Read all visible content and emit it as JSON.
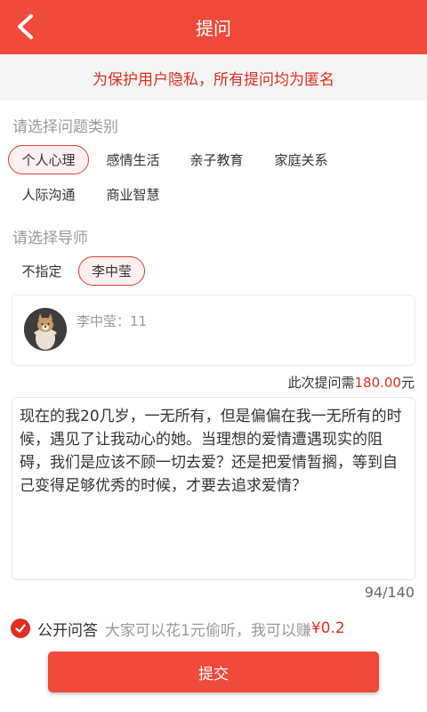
{
  "header": {
    "title": "提问"
  },
  "banner": {
    "text": "为保护用户隐私，所有提问均为匿名"
  },
  "category": {
    "title": "请选择问题类别",
    "options": [
      "个人心理",
      "感情生活",
      "亲子教育",
      "家庭关系",
      "人际沟通",
      "商业智慧"
    ],
    "selected": "个人心理"
  },
  "mentor": {
    "title": "请选择导师",
    "options": [
      "不指定",
      "李中莹"
    ],
    "selected": "李中莹",
    "card_text": "李中莹：11"
  },
  "price": {
    "prefix": "此次提问需",
    "amount": "180.00",
    "suffix": "元"
  },
  "question": {
    "text": "现在的我20几岁，一无所有，但是偏偏在我一无所有的时候，遇见了让我动心的她。当理想的爱情遭遇现实的阻碍，我们是应该不顾一切去爱？还是把爱情暂搁，等到自己变得足够优秀的时候，才要去追求爱情？",
    "counter": "94/140"
  },
  "public_answer": {
    "checked": true,
    "label": "公开问答",
    "hint": "大家可以花1元偷听，我可以赚",
    "earn": "¥0.2"
  },
  "submit": {
    "label": "提交"
  },
  "colors": {
    "accent": "#f04a3b",
    "price": "#e02e22"
  }
}
